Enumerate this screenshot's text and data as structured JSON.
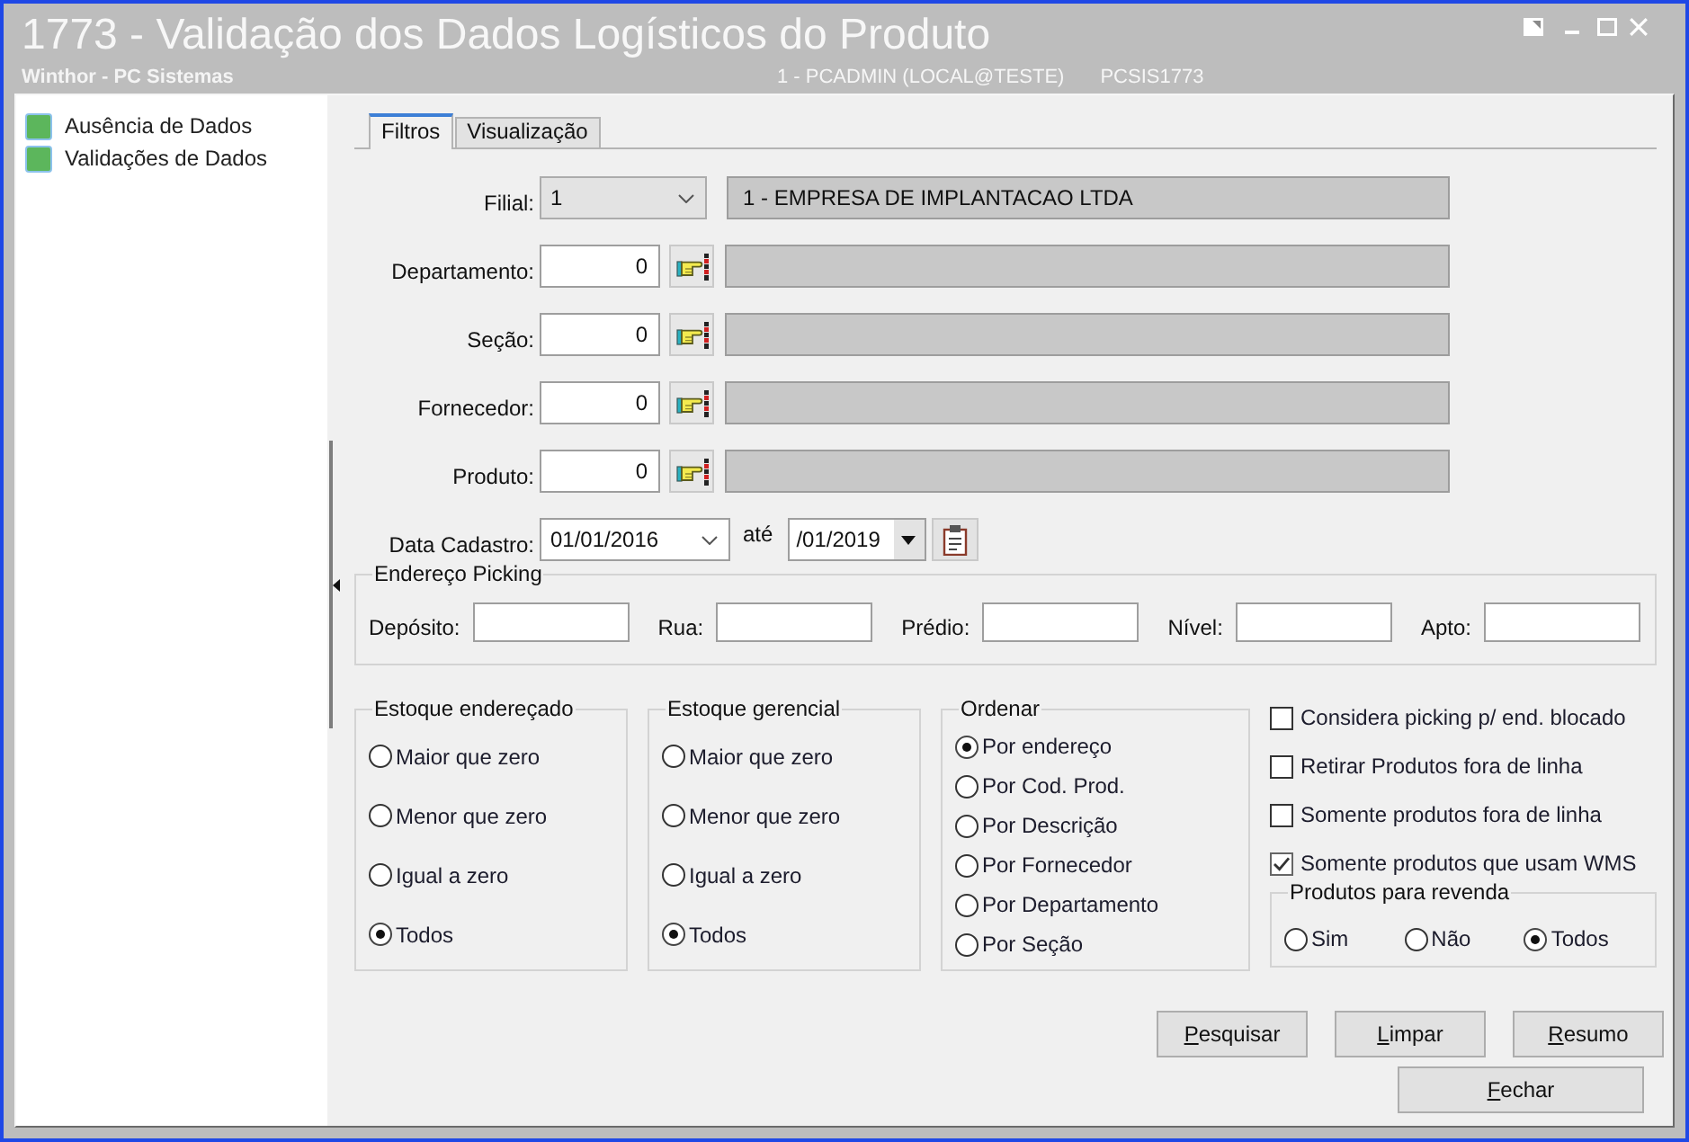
{
  "window": {
    "title": "1773 - Validação dos Dados Logísticos do Produto",
    "subtitle": "Winthor - PC Sistemas",
    "session": "1 - PCADMIN (LOCAL@TESTE)",
    "program": "PCSIS1773"
  },
  "sidebar": {
    "items": [
      {
        "label": "Ausência de Dados"
      },
      {
        "label": "Validações de Dados"
      }
    ]
  },
  "tabs": [
    {
      "label": "Filtros",
      "selected": true
    },
    {
      "label": "Visualização",
      "selected": false
    }
  ],
  "filial": {
    "label": "Filial:",
    "value": "1",
    "description": "1 - EMPRESA DE IMPLANTACAO LTDA"
  },
  "lookups": [
    {
      "label": "Departamento:",
      "value": "0"
    },
    {
      "label": "Seção:",
      "value": "0"
    },
    {
      "label": "Fornecedor:",
      "value": "0"
    },
    {
      "label": "Produto:",
      "value": "0"
    }
  ],
  "date_range": {
    "label": "Data Cadastro:",
    "from": "01/01/2016",
    "separator": "até",
    "to": "/01/2019"
  },
  "picking": {
    "title": "Endereço Picking",
    "fields": [
      {
        "label": "Depósito:"
      },
      {
        "label": "Rua:"
      },
      {
        "label": "Prédio:"
      },
      {
        "label": "Nível:"
      },
      {
        "label": "Apto:"
      }
    ]
  },
  "radio_groups": [
    {
      "title": "Estoque endereçado",
      "options": [
        {
          "label": "Maior que zero",
          "selected": false
        },
        {
          "label": "Menor que zero",
          "selected": false
        },
        {
          "label": "Igual a zero",
          "selected": false
        },
        {
          "label": "Todos",
          "selected": true
        }
      ]
    },
    {
      "title": "Estoque gerencial",
      "options": [
        {
          "label": "Maior que zero",
          "selected": false
        },
        {
          "label": "Menor que zero",
          "selected": false
        },
        {
          "label": "Igual a zero",
          "selected": false
        },
        {
          "label": "Todos",
          "selected": true
        }
      ]
    },
    {
      "title": "Ordenar",
      "options": [
        {
          "label": "Por endereço",
          "selected": true
        },
        {
          "label": "Por Cod. Prod.",
          "selected": false
        },
        {
          "label": "Por Descrição",
          "selected": false
        },
        {
          "label": "Por Fornecedor",
          "selected": false
        },
        {
          "label": "Por Departamento",
          "selected": false
        },
        {
          "label": "Por Seção",
          "selected": false
        }
      ]
    }
  ],
  "checkboxes": [
    {
      "label": "Considera picking p/ end. blocado",
      "checked": false
    },
    {
      "label": "Retirar Produtos fora de linha",
      "checked": false
    },
    {
      "label": "Somente produtos fora de linha",
      "checked": false
    },
    {
      "label": "Somente produtos que usam WMS",
      "checked": true
    }
  ],
  "revenda": {
    "title": "Produtos para revenda",
    "options": [
      {
        "label": "Sim",
        "selected": false
      },
      {
        "label": "Não",
        "selected": false
      },
      {
        "label": "Todos",
        "selected": true
      }
    ]
  },
  "buttons": [
    "Pesquisar",
    "Limpar",
    "Resumo",
    "Fechar"
  ]
}
